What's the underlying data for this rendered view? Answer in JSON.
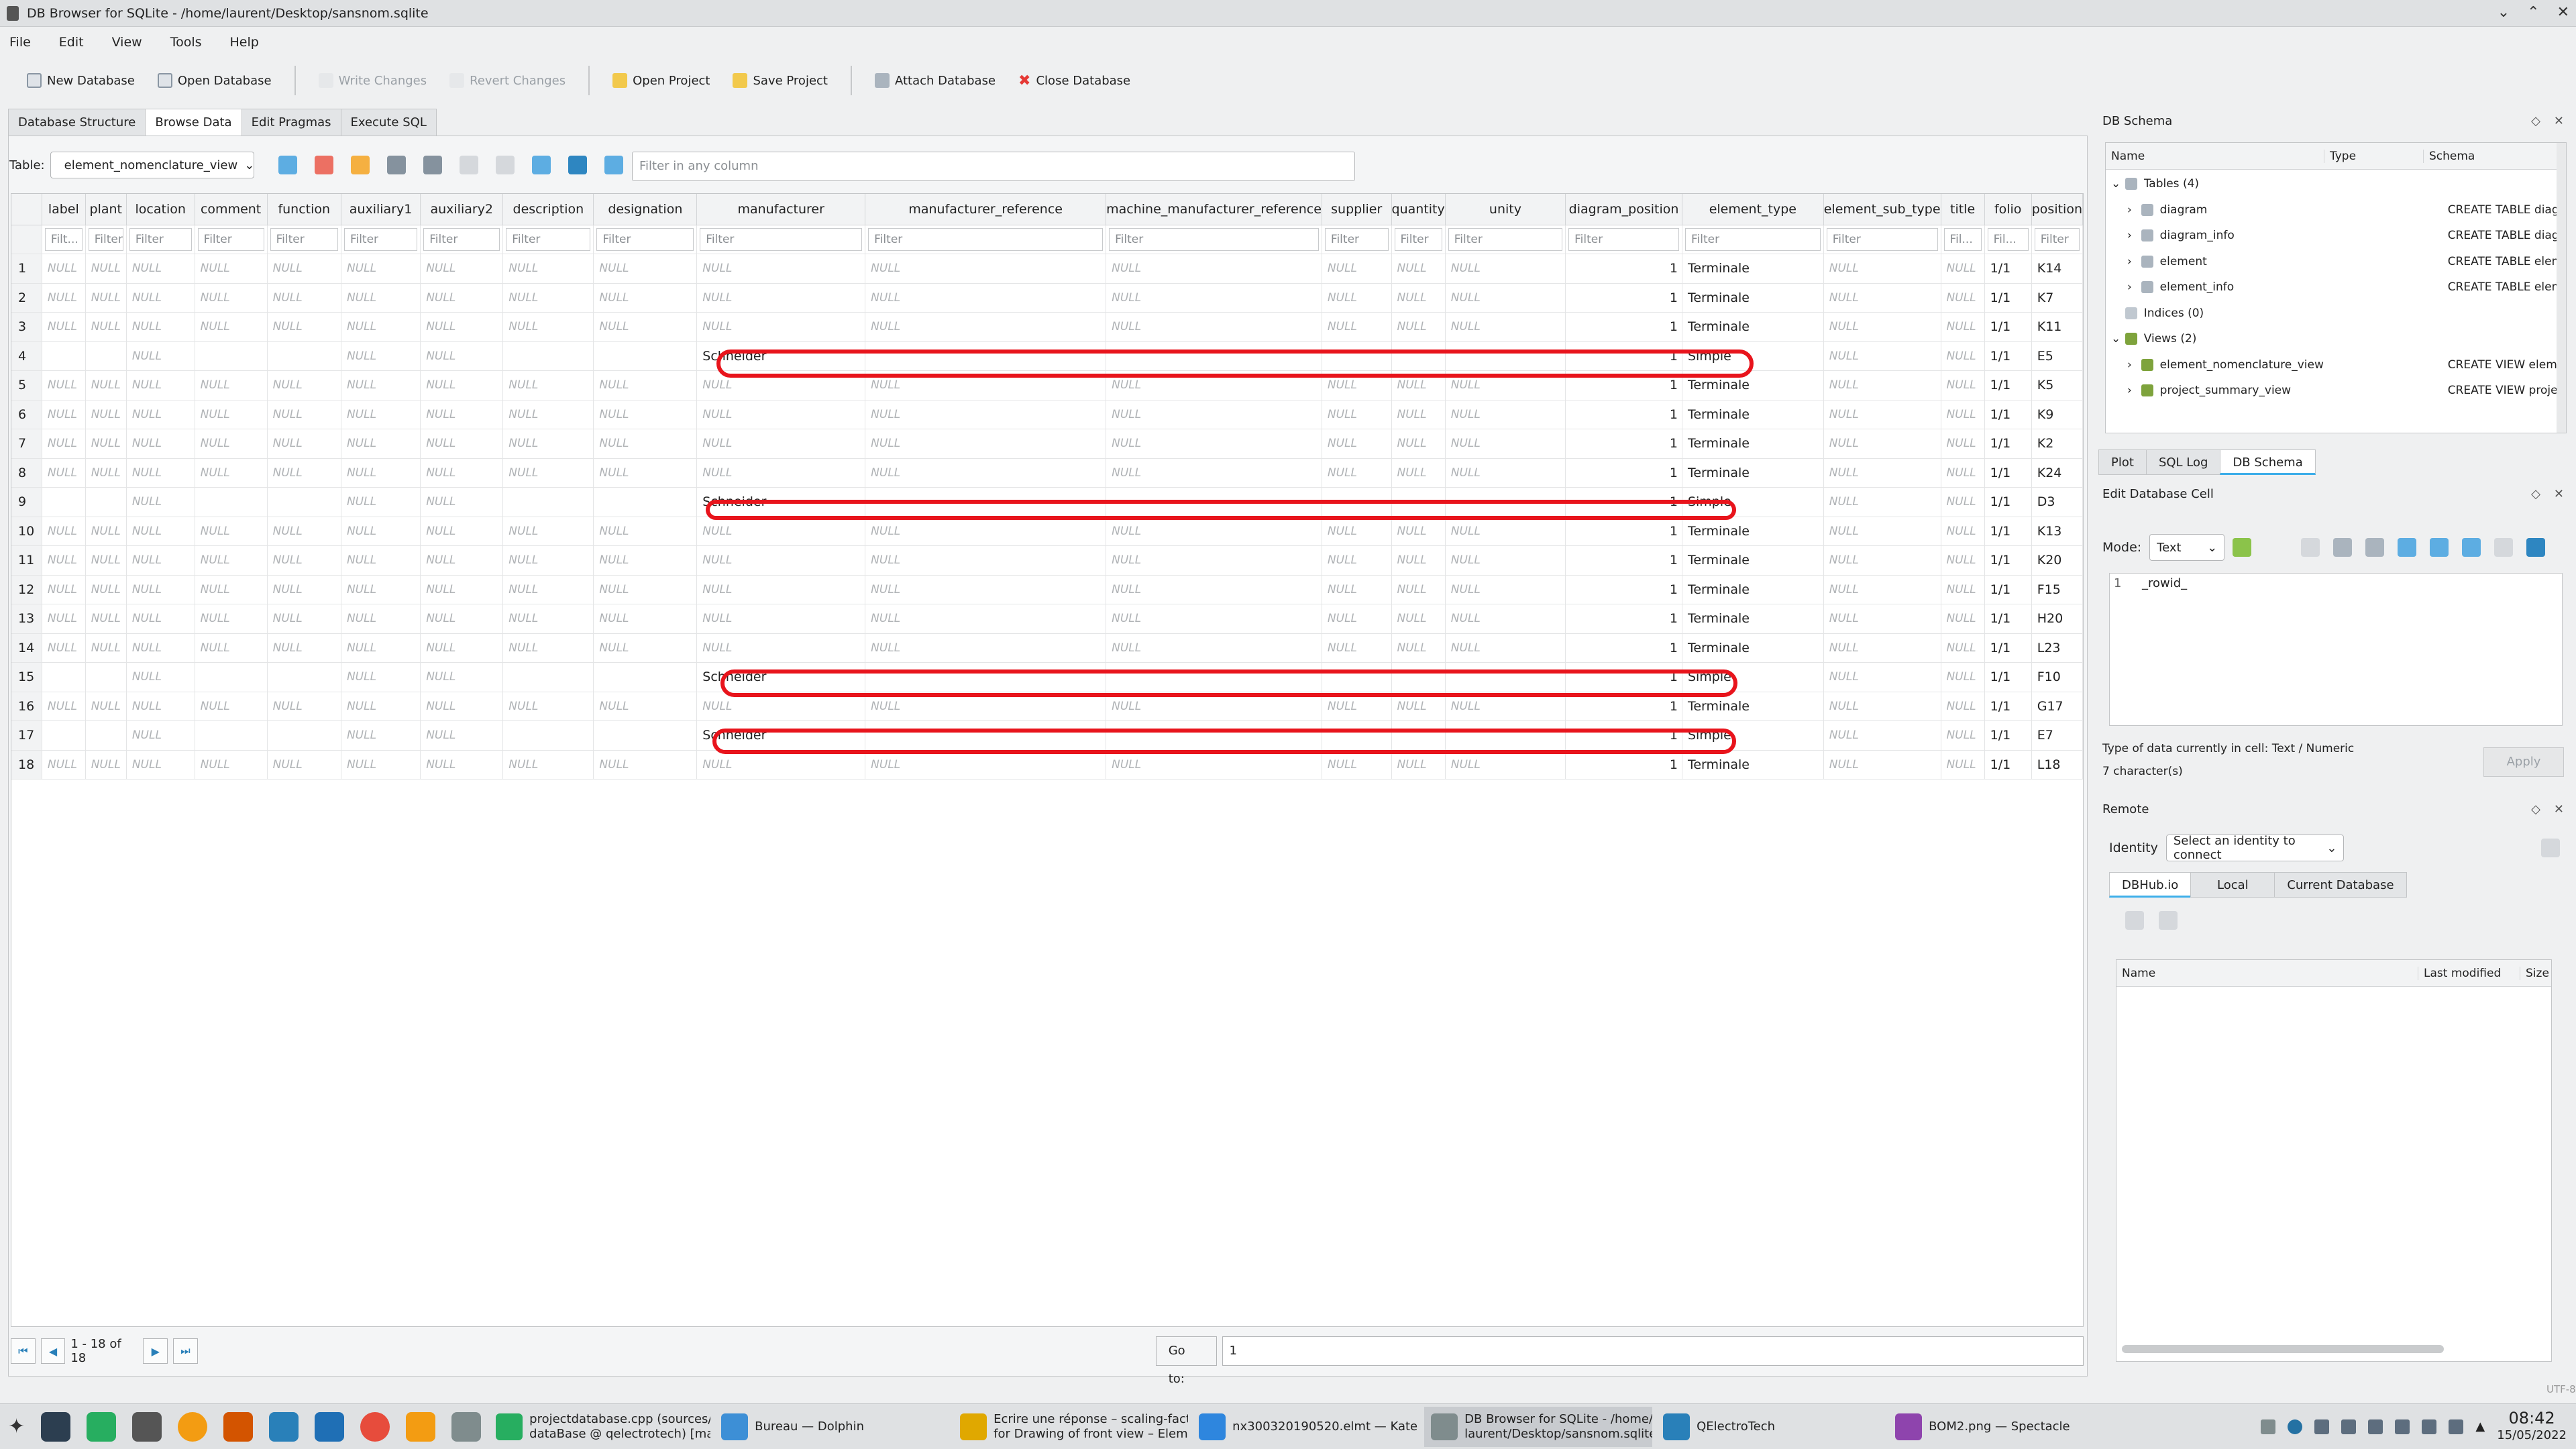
{
  "window": {
    "title": "DB Browser for SQLite - /home/laurent/Desktop/sansnom.sqlite"
  },
  "menu": [
    "File",
    "Edit",
    "View",
    "Tools",
    "Help"
  ],
  "toolbar": {
    "new_db": "New Database",
    "open_db": "Open Database",
    "write": "Write Changes",
    "revert": "Revert Changes",
    "open_project": "Open Project",
    "save_project": "Save Project",
    "attach": "Attach Database",
    "close_db": "Close Database"
  },
  "tabs": [
    "Database Structure",
    "Browse Data",
    "Edit Pragmas",
    "Execute SQL"
  ],
  "browse": {
    "table_label": "Table:",
    "table_value": "element_nomenclature_view",
    "filter_placeholder": "Filter in any column"
  },
  "grid": {
    "columns": [
      "label",
      "plant",
      "location",
      "comment",
      "function",
      "auxiliary1",
      "auxiliary2",
      "description",
      "designation",
      "manufacturer",
      "manufacturer_reference",
      "machine_manufacturer_reference",
      "supplier",
      "quantity",
      "unity",
      "diagram_position",
      "element_type",
      "element_sub_type",
      "title",
      "folio",
      "position"
    ],
    "filters": [
      "Filt...",
      "Filter",
      "Filter",
      "Filter",
      "Filter",
      "Filter",
      "Filter",
      "Filter",
      "Filter",
      "Filter",
      "Filter",
      "Filter",
      "Filter",
      "Filter",
      "Filter",
      "Filter",
      "Filter",
      "Filter",
      "Fil...",
      "Fil...",
      "Filter"
    ],
    "null_text": "NULL",
    "rows": [
      {
        "n": "1",
        "manufacturer": "",
        "diagram_position": "1",
        "element_type": "Terminale",
        "folio": "1/1",
        "position": "K14",
        "full_null": true
      },
      {
        "n": "2",
        "manufacturer": "",
        "diagram_position": "1",
        "element_type": "Terminale",
        "folio": "1/1",
        "position": "K7",
        "full_null": true
      },
      {
        "n": "3",
        "manufacturer": "",
        "diagram_position": "1",
        "element_type": "Terminale",
        "folio": "1/1",
        "position": "K11",
        "full_null": true
      },
      {
        "n": "4",
        "manufacturer": "Schneider",
        "diagram_position": "1",
        "element_type": "Simple",
        "folio": "1/1",
        "position": "E5",
        "full_null": false
      },
      {
        "n": "5",
        "manufacturer": "",
        "diagram_position": "1",
        "element_type": "Terminale",
        "folio": "1/1",
        "position": "K5",
        "full_null": true
      },
      {
        "n": "6",
        "manufacturer": "",
        "diagram_position": "1",
        "element_type": "Terminale",
        "folio": "1/1",
        "position": "K9",
        "full_null": true
      },
      {
        "n": "7",
        "manufacturer": "",
        "diagram_position": "1",
        "element_type": "Terminale",
        "folio": "1/1",
        "position": "K2",
        "full_null": true
      },
      {
        "n": "8",
        "manufacturer": "",
        "diagram_position": "1",
        "element_type": "Terminale",
        "folio": "1/1",
        "position": "K24",
        "full_null": true
      },
      {
        "n": "9",
        "manufacturer": "Schneider",
        "diagram_position": "1",
        "element_type": "Simple",
        "folio": "1/1",
        "position": "D3",
        "full_null": false
      },
      {
        "n": "10",
        "manufacturer": "",
        "diagram_position": "1",
        "element_type": "Terminale",
        "folio": "1/1",
        "position": "K13",
        "full_null": true
      },
      {
        "n": "11",
        "manufacturer": "",
        "diagram_position": "1",
        "element_type": "Terminale",
        "folio": "1/1",
        "position": "K20",
        "full_null": true
      },
      {
        "n": "12",
        "manufacturer": "",
        "diagram_position": "1",
        "element_type": "Terminale",
        "folio": "1/1",
        "position": "F15",
        "full_null": true
      },
      {
        "n": "13",
        "manufacturer": "",
        "diagram_position": "1",
        "element_type": "Terminale",
        "folio": "1/1",
        "position": "H20",
        "full_null": true
      },
      {
        "n": "14",
        "manufacturer": "",
        "diagram_position": "1",
        "element_type": "Terminale",
        "folio": "1/1",
        "position": "L23",
        "full_null": true
      },
      {
        "n": "15",
        "manufacturer": "Schneider",
        "diagram_position": "1",
        "element_type": "Simple",
        "folio": "1/1",
        "position": "F10",
        "full_null": false
      },
      {
        "n": "16",
        "manufacturer": "",
        "diagram_position": "1",
        "element_type": "Terminale",
        "folio": "1/1",
        "position": "G17",
        "full_null": true
      },
      {
        "n": "17",
        "manufacturer": "Schneider",
        "diagram_position": "1",
        "element_type": "Simple",
        "folio": "1/1",
        "position": "E7",
        "full_null": false
      },
      {
        "n": "18",
        "manufacturer": "",
        "diagram_position": "1",
        "element_type": "Terminale",
        "folio": "1/1",
        "position": "L18",
        "full_null": true
      }
    ]
  },
  "pager": {
    "range": "1 - 18 of 18",
    "goto_label": "Go to:",
    "goto_value": "1"
  },
  "schema": {
    "title": "DB Schema",
    "headers": [
      "Name",
      "Type",
      "Schema"
    ],
    "rows": [
      {
        "name": "Tables (4)",
        "schema": ""
      },
      {
        "name": "diagram",
        "schema": "CREATE TABLE diagram"
      },
      {
        "name": "diagram_info",
        "schema": "CREATE TABLE diagram_"
      },
      {
        "name": "element",
        "schema": "CREATE TABLE element("
      },
      {
        "name": "element_info",
        "schema": "CREATE TABLE element_"
      },
      {
        "name": "Indices (0)",
        "schema": ""
      },
      {
        "name": "Views (2)",
        "schema": ""
      },
      {
        "name": "element_nomenclature_view",
        "schema": "CREATE VIEW element_"
      },
      {
        "name": "project_summary_view",
        "schema": "CREATE VIEW project_s"
      }
    ]
  },
  "side_tabs": [
    "Plot",
    "SQL Log",
    "DB Schema"
  ],
  "editcell": {
    "title": "Edit Database Cell",
    "mode_label": "Mode:",
    "mode_value": "Text",
    "line_no": "1",
    "content": "_rowid_",
    "type_info": "Type of data currently in cell: Text / Numeric",
    "chars": "7 character(s)",
    "apply": "Apply"
  },
  "remote": {
    "title": "Remote",
    "identity_label": "Identity",
    "identity_value": "Select an identity to connect",
    "tabs": [
      "DBHub.io",
      "Local",
      "Current Database"
    ],
    "headers": [
      "Name",
      "Last modified",
      "Size"
    ]
  },
  "status": {
    "encoding": "UTF-8"
  },
  "taskbar": {
    "items": [
      {
        "l1": "projectdatabase.cpp (sources/",
        "l2": "dataBase @ qelectrotech) [master...",
        "color": "#27ae60"
      },
      {
        "l1": "Bureau — Dolphin",
        "l2": "",
        "color": "#3d8fd6"
      },
      {
        "l1": "Ecrire une réponse – scaling-factor",
        "l2": "for Drawing of front view – Eleme...",
        "color": "#e0a800"
      },
      {
        "l1": "nx300320190520.elmt — Kate",
        "l2": "",
        "color": "#2e86de"
      },
      {
        "l1": "DB Browser for SQLite - /home/",
        "l2": "laurent/Desktop/sansnom.sqlite",
        "color": "#7f8c8d"
      },
      {
        "l1": "QElectroTech",
        "l2": "",
        "color": "#2980b9"
      },
      {
        "l1": "BOM2.png — Spectacle",
        "l2": "",
        "color": "#8e44ad"
      }
    ],
    "time": "08:42",
    "date": "15/05/2022"
  }
}
